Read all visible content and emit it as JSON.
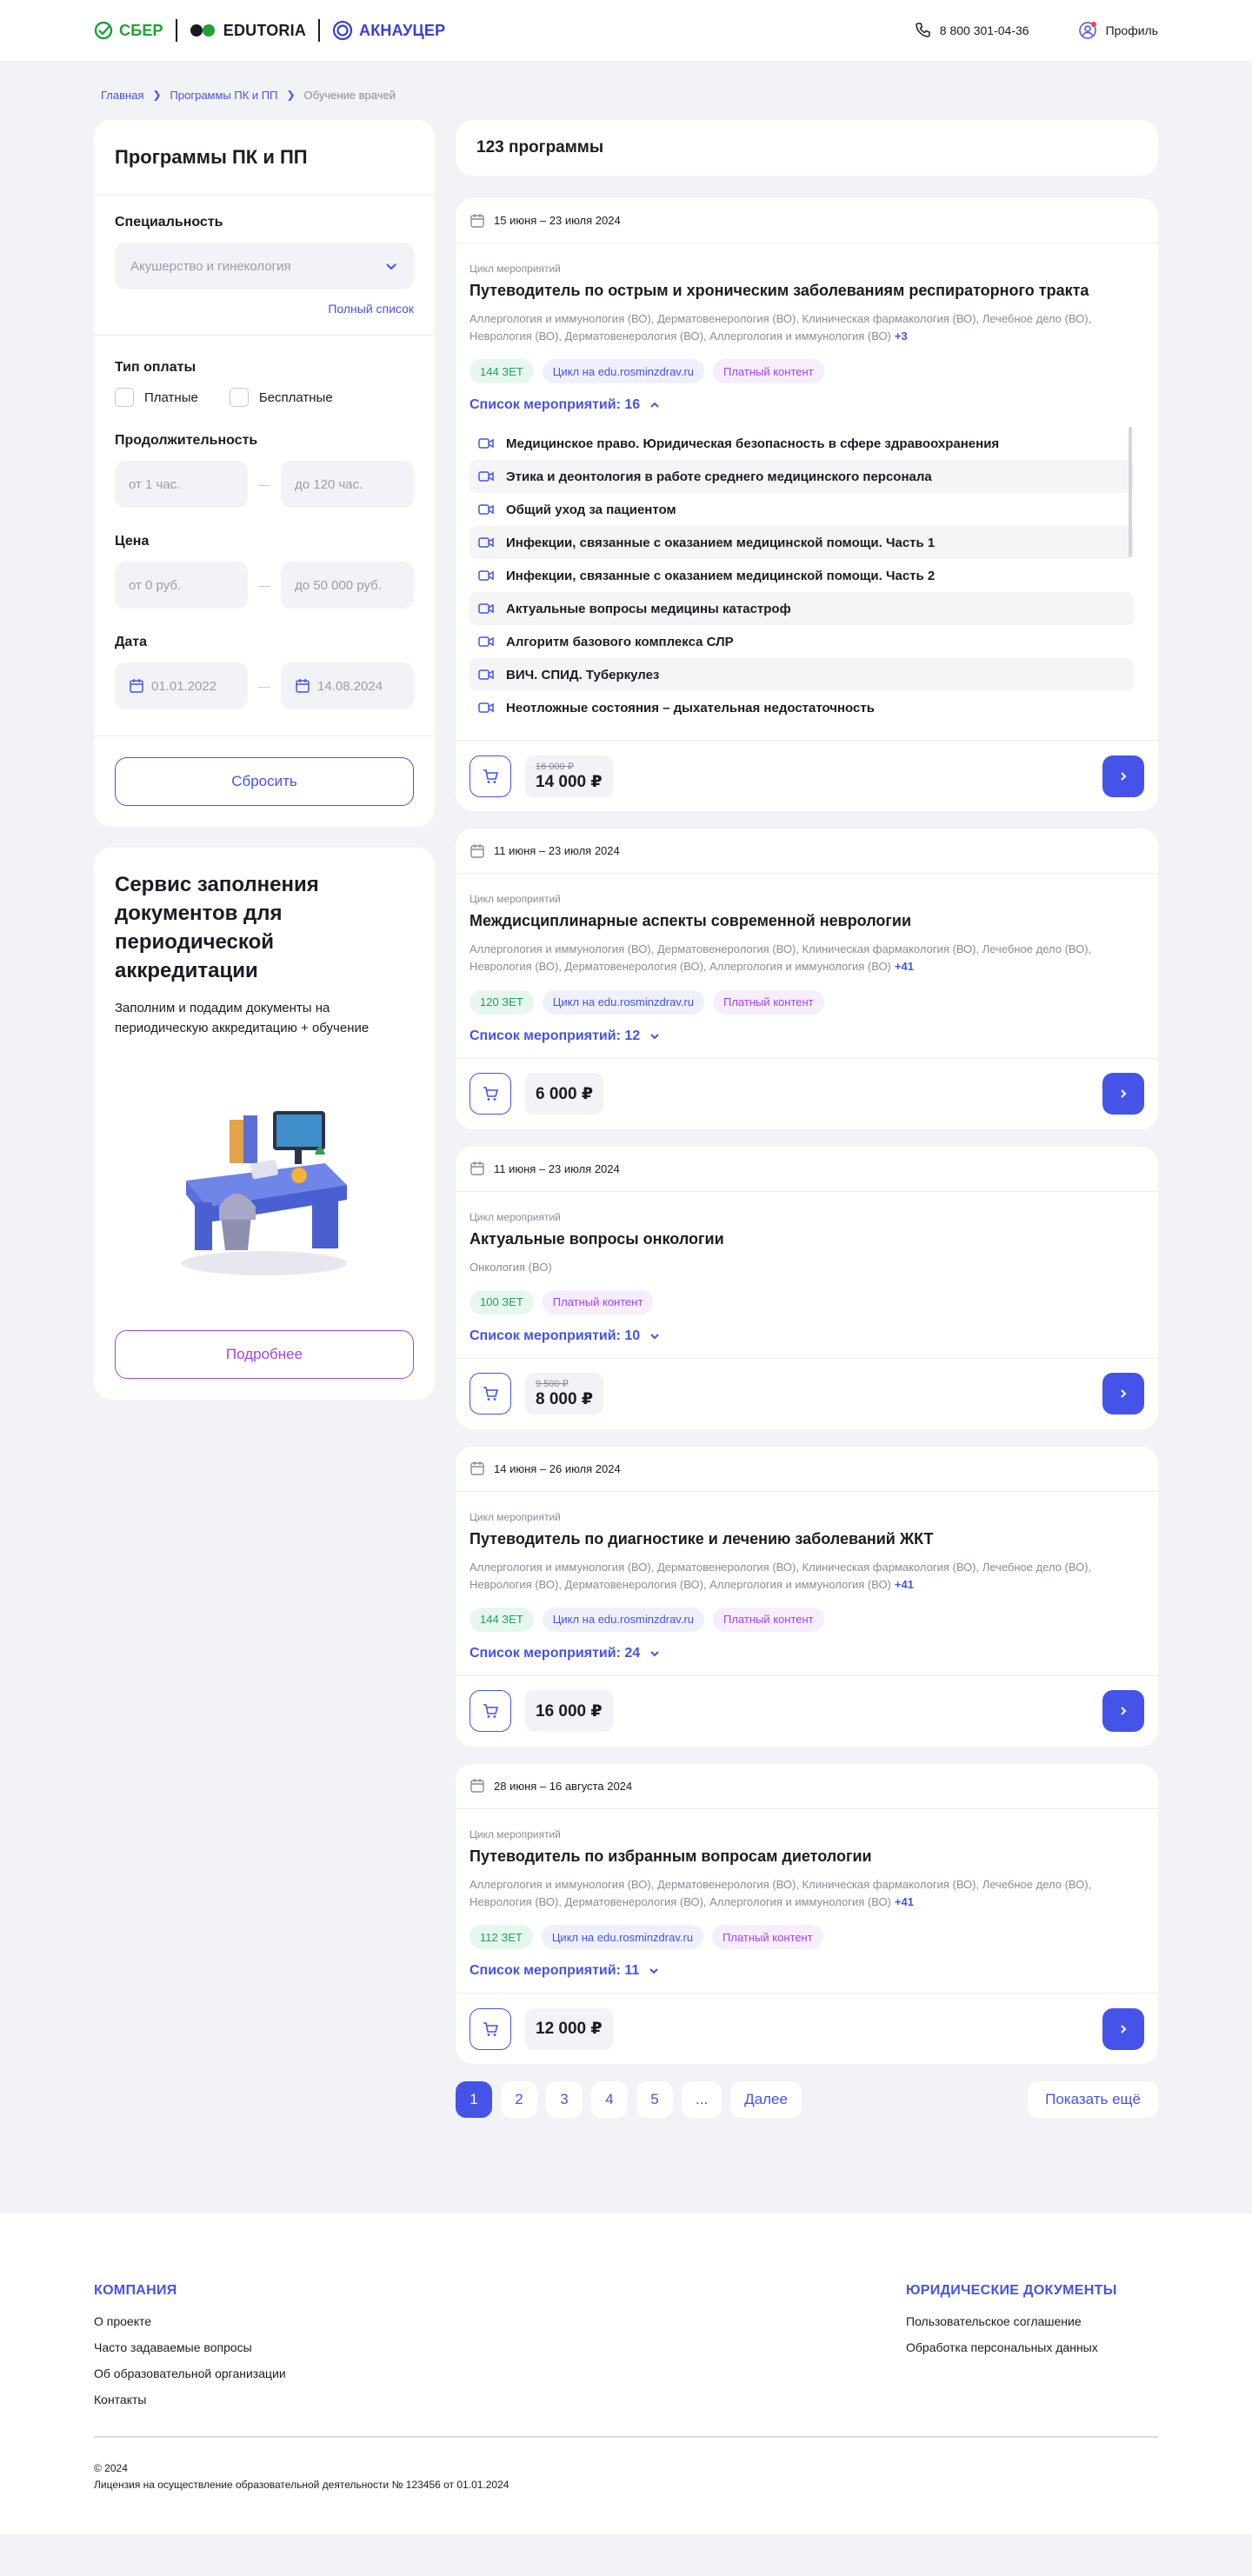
{
  "header": {
    "logos": [
      "СБЕР",
      "EDUTORIA",
      "АКНАУЦЕР"
    ],
    "phone": "8 800 301-04-36",
    "profile": "Профиль"
  },
  "breadcrumb": {
    "home": "Главная",
    "section": "Программы ПК и ПП",
    "current": "Обучение врачей"
  },
  "filters": {
    "title": "Программы ПК и ПП",
    "specialty_label": "Специальность",
    "specialty_value": "Акушерство и гинекология",
    "full_list": "Полный список",
    "payment_label": "Тип оплаты",
    "paid": "Платные",
    "free": "Бесплатные",
    "duration_label": "Продолжительность",
    "duration_from": "от 1 час.",
    "duration_to": "до 120 час.",
    "price_label": "Цена",
    "price_from": "от 0 руб.",
    "price_to": "до 50 000 руб.",
    "date_label": "Дата",
    "date_from": "01.01.2022",
    "date_to": "14.08.2024",
    "reset": "Сбросить"
  },
  "promo": {
    "title": "Сервис заполнения документов для периодической аккредитации",
    "text": "Заполним и подадим документы на периодическую аккредитацию + обучение",
    "button": "Подробнее"
  },
  "count": "123 программы",
  "cards": [
    {
      "date": "15 июня – 23 июля 2024",
      "category": "Цикл мероприятий",
      "title": "Путеводитель по острым и хроническим заболеваниям респираторного тракта",
      "spec": "Аллергология и иммунология (ВО), Дерматовенерология (ВО), Клиническая фармакология (ВО), Лечебное дело (ВО), Неврология (ВО), Дерматовенерология (ВО), Аллергология и иммунология (ВО)",
      "more": "+3",
      "tag1": "144 ЗЕТ",
      "tag2": "Цикл на edu.rosminzdrav.ru",
      "tag3": "Платный контент",
      "events_label": "Список мероприятий: 16",
      "events": [
        "Медицинское право. Юридическая безопасность в сфере здравоохранения",
        "Этика и деонтология в работе среднего медицинского персонала",
        "Общий уход за пациентом",
        "Инфекции, связанные с оказанием медицинской помощи. Часть 1",
        "Инфекции, связанные с оказанием медицинской помощи. Часть 2",
        "Актуальные вопросы медицины катастроф",
        "Алгоритм базового комплекса СЛР",
        "ВИЧ. СПИД. Туберкулез",
        "Неотложные состояния – дыхательная недостаточность"
      ],
      "old_price": "16 000 ₽",
      "price": "14 000 ₽"
    },
    {
      "date": "11 июня – 23 июля 2024",
      "category": "Цикл мероприятий",
      "title": "Междисциплинарные аспекты современной неврологии",
      "spec": "Аллергология и иммунология (ВО), Дерматовенерология (ВО), Клиническая фармакология (ВО), Лечебное дело (ВО), Неврология (ВО), Дерматовенерология (ВО), Аллергология и иммунология (ВО)",
      "more": "+41",
      "tag1": "120 ЗЕТ",
      "tag2": "Цикл на edu.rosminzdrav.ru",
      "tag3": "Платный контент",
      "events_label": "Список мероприятий: 12",
      "price": "6 000 ₽"
    },
    {
      "date": "11 июня – 23 июля 2024",
      "category": "Цикл мероприятий",
      "title": "Актуальные вопросы онкологии",
      "spec": "Онкология (ВО)",
      "tag1": "100 ЗЕТ",
      "tag3": "Платный контент",
      "events_label": "Список мероприятий: 10",
      "old_price": "9 500 ₽",
      "price": "8 000 ₽"
    },
    {
      "date": "14 июня – 26 июля 2024",
      "category": "Цикл мероприятий",
      "title": "Путеводитель по диагностике и лечению заболеваний ЖКТ",
      "spec": "Аллергология и иммунология (ВО), Дерматовенерология (ВО), Клиническая фармакология (ВО), Лечебное дело (ВО), Неврология (ВО), Дерматовенерология (ВО), Аллергология и иммунология (ВО)",
      "more": "+41",
      "tag1": "144 ЗЕТ",
      "tag2": "Цикл на edu.rosminzdrav.ru",
      "tag3": "Платный контент",
      "events_label": "Список мероприятий: 24",
      "price": "16 000 ₽"
    },
    {
      "date": "28 июня – 16 августа 2024",
      "category": "Цикл мероприятий",
      "title": "Путеводитель по избранным вопросам диетологии",
      "spec": "Аллергология и иммунология (ВО), Дерматовенерология (ВО), Клиническая фармакология (ВО), Лечебное дело (ВО), Неврология (ВО), Дерматовенерология (ВО), Аллергология и иммунология (ВО)",
      "more": "+41",
      "tag1": "112 ЗЕТ",
      "tag2": "Цикл на edu.rosminzdrav.ru",
      "tag3": "Платный контент",
      "events_label": "Список мероприятий: 11",
      "price": "12 000 ₽"
    }
  ],
  "pager": {
    "pages": [
      "1",
      "2",
      "3",
      "4",
      "5",
      "..."
    ],
    "next": "Далее",
    "show_more": "Показать ещё"
  },
  "footer": {
    "company_head": "КОМПАНИЯ",
    "company_links": [
      "О проекте",
      "Часто задаваемые вопросы",
      "Об образовательной организации",
      "Контакты"
    ],
    "legal_head": "ЮРИДИЧЕСКИЕ ДОКУМЕНТЫ",
    "legal_links": [
      "Пользовательское соглашение",
      "Обработка персональных данных"
    ],
    "copyright": "© 2024",
    "license": "Лицензия на осуществление образовательной деятельности № 123456 от 01.01.2024"
  },
  "colors": {
    "accent": "#4553e8",
    "purple": "#a544e8",
    "green": "#1da15b",
    "sber": "#21a038",
    "bg": "#f2f3f7"
  },
  "icons": [
    "phone-icon",
    "profile-icon",
    "chevron-right-icon",
    "chevron-down-icon",
    "checkbox-icon",
    "calendar-icon",
    "video-icon",
    "cart-icon",
    "arrow-right-icon",
    "chevron-up-icon"
  ]
}
